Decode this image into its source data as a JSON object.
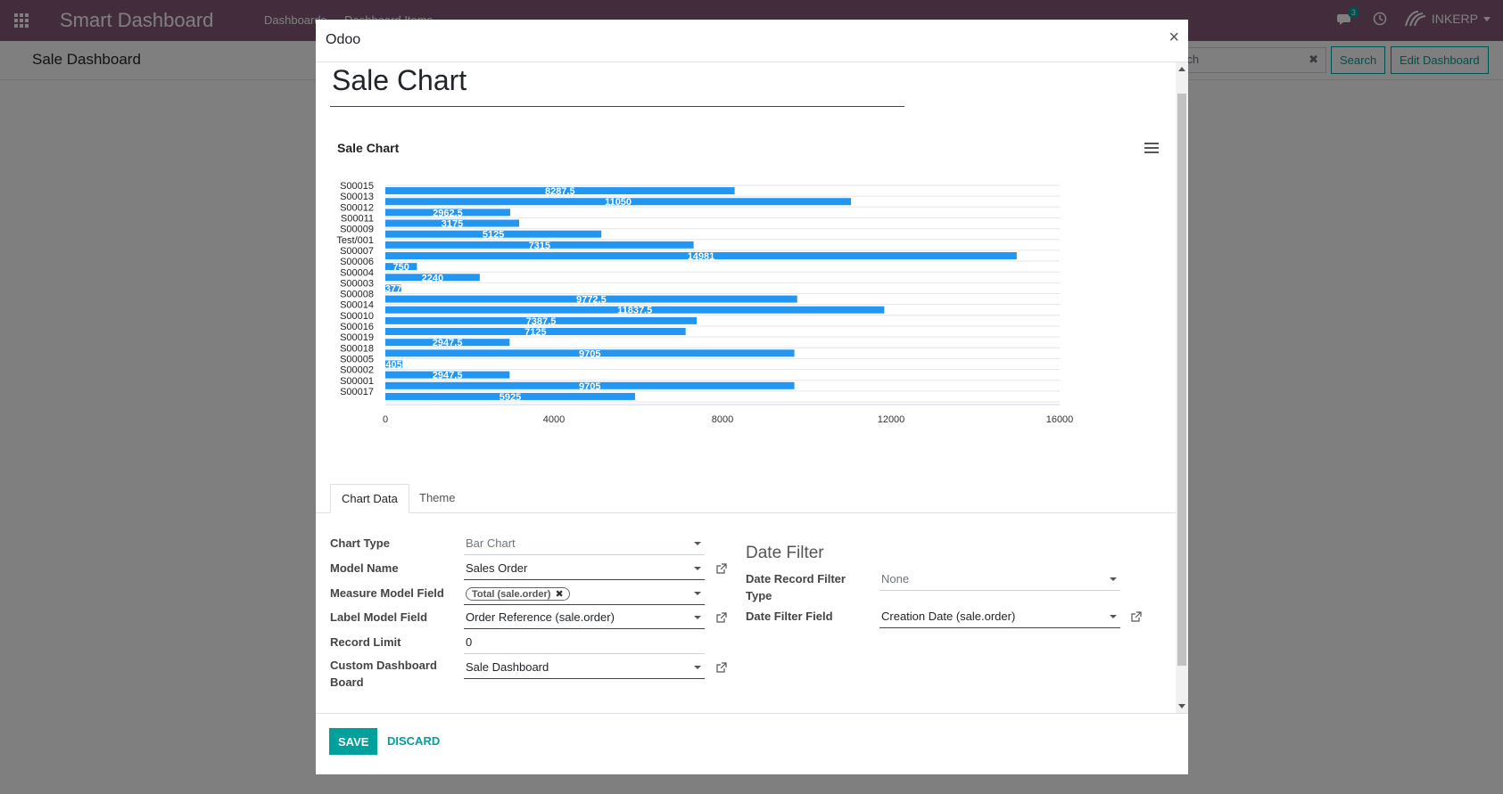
{
  "navbar": {
    "brand": "Smart Dashboard",
    "menu": [
      "Dashboards",
      "Dashboard Items"
    ],
    "chat_count": "3",
    "company": "INKERP"
  },
  "control_panel": {
    "title": "Sale Dashboard",
    "search_text": "rch",
    "search_button": "Search",
    "edit_button": "Edit Dashboard"
  },
  "modal": {
    "title": "Odoo",
    "close": "×",
    "record_name": "Sale Chart",
    "tabs": [
      "Chart Data",
      "Theme"
    ],
    "save": "SAVE",
    "discard": "DISCARD"
  },
  "form": {
    "chart_type": {
      "label": "Chart Type",
      "value": "Bar Chart"
    },
    "model_name": {
      "label": "Model Name",
      "value": "Sales Order"
    },
    "measure_field": {
      "label": "Measure Model Field",
      "tag": "Total (sale.order)"
    },
    "label_field": {
      "label": "Label Model Field",
      "value": "Order Reference (sale.order)"
    },
    "record_limit": {
      "label": "Record Limit",
      "value": "0"
    },
    "custom_board": {
      "label_line1": "Custom Dashboard",
      "label_line2": "Board",
      "value": "Sale Dashboard"
    },
    "date_filter_title": "Date Filter",
    "date_record_filter": {
      "label_line1": "Date Record Filter",
      "label_line2": "Type",
      "value": "None"
    },
    "date_filter_field": {
      "label": "Date Filter Field",
      "value": "Creation Date (sale.order)"
    }
  },
  "chart_data": {
    "type": "bar",
    "orientation": "horizontal",
    "title": "Sale Chart",
    "categories": [
      "S00015",
      "S00013",
      "S00012",
      "S00011",
      "S00009",
      "Test/001",
      "S00007",
      "S00006",
      "S00004",
      "S00003",
      "S00008",
      "S00014",
      "S00010",
      "S00016",
      "S00019",
      "S00018",
      "S00005",
      "S00002",
      "S00001",
      "S00017"
    ],
    "values": [
      8287.5,
      11050,
      2962.5,
      3175,
      5125,
      7315,
      14981,
      750,
      2240,
      377,
      9772.5,
      11837.5,
      7387.5,
      7125,
      2947.5,
      9705,
      405,
      2947.5,
      9705,
      5925
    ],
    "labels": [
      "8287.5",
      "11050",
      "2962.5",
      "3175",
      "5125",
      "7315",
      "14981",
      "750",
      "2240",
      "377",
      "9772.5",
      "11837.5",
      "7387.5",
      "7125",
      "2947.5",
      "9705",
      "405",
      "2947.5",
      "9705",
      "5925"
    ],
    "xlim": [
      0,
      16000
    ],
    "xticks": [
      "0",
      "4000",
      "8000",
      "12000",
      "16000"
    ],
    "grid": true,
    "color": "#2196F3"
  }
}
